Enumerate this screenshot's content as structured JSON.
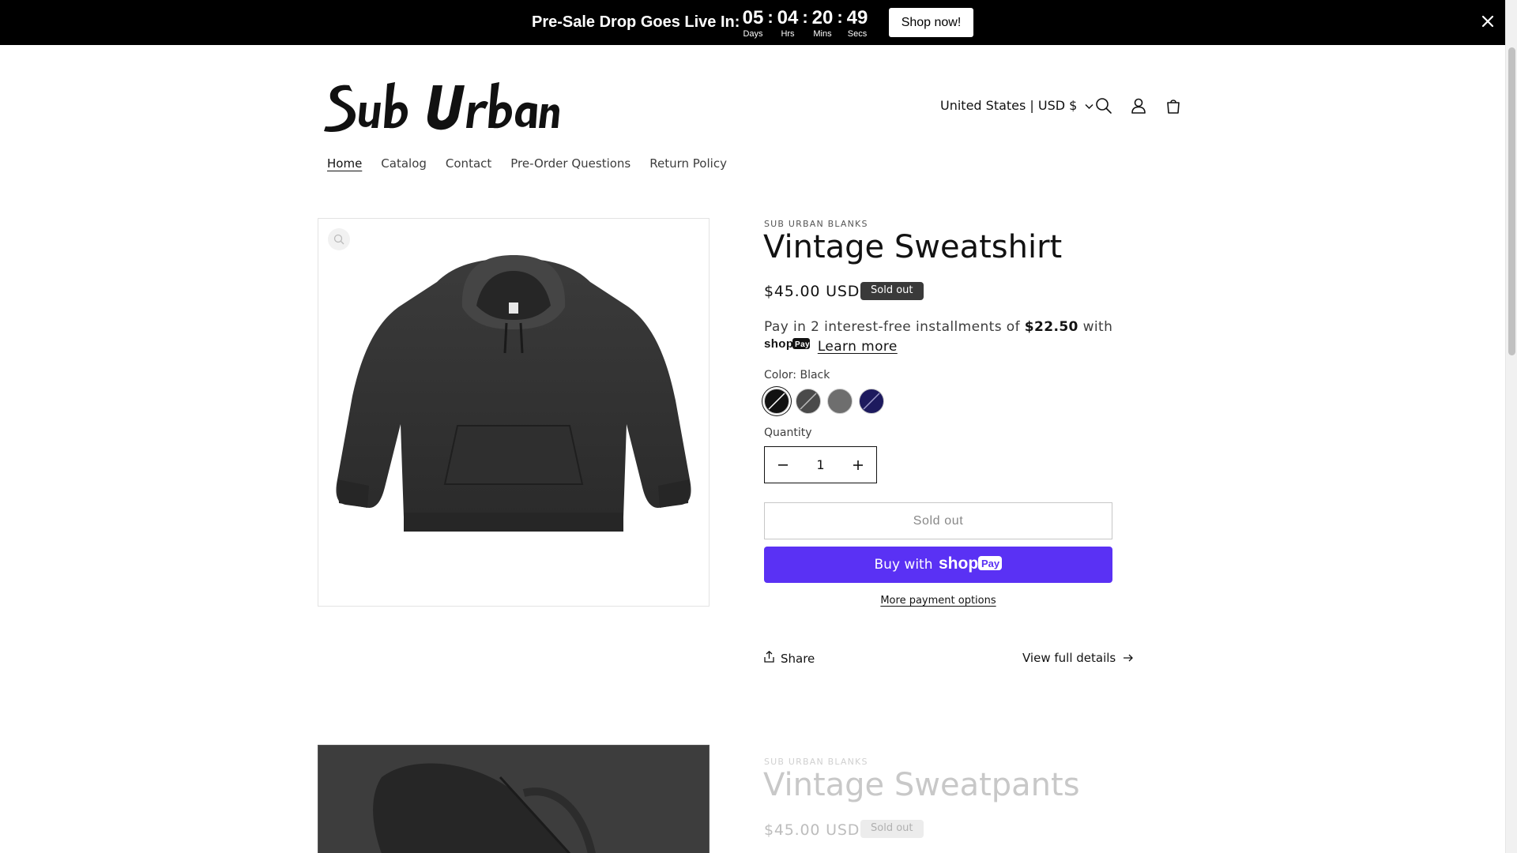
{
  "announcement": {
    "title": "Pre-Sale Drop Goes Live In:",
    "countdown": {
      "days": "05",
      "days_label": "Days",
      "hours": "04",
      "hours_label": "Hrs",
      "mins": "20",
      "mins_label": "Mins",
      "secs": "49",
      "secs_label": "Secs",
      "separator": ":"
    },
    "cta_label": "Shop now!",
    "close_icon": "close-icon"
  },
  "header": {
    "logo_text": "Sub Urban",
    "localization_label": "United States | USD $",
    "icons": [
      "search-icon",
      "account-icon",
      "cart-icon"
    ]
  },
  "nav": {
    "items": [
      {
        "label": "Home",
        "active": true
      },
      {
        "label": "Catalog"
      },
      {
        "label": "Contact"
      },
      {
        "label": "Pre-Order Questions"
      },
      {
        "label": "Return Policy"
      }
    ]
  },
  "product": {
    "vendor": "SUB URBAN BLANKS",
    "title": "Vintage Sweatshirt",
    "price": "$45.00 USD",
    "badge": "Sold out",
    "installments": {
      "prefix": "Pay in 2 interest-free installments of",
      "amount": "$22.50",
      "suffix": "with",
      "learn_more": "Learn more"
    },
    "color_label": "Color: Black",
    "swatches": [
      {
        "name": "Black",
        "color": "#121212",
        "selected": true,
        "crossed": true
      },
      {
        "name": "Charcoal",
        "color": "#4a4a4a",
        "crossed": true
      },
      {
        "name": "Grey",
        "color": "#6e6e6e",
        "crossed": false
      },
      {
        "name": "Navy",
        "color": "#1d1a5e",
        "crossed": true
      }
    ],
    "quantity_label": "Quantity",
    "quantity_value": "1",
    "sold_out_button": "Sold out",
    "buy_with_label": "Buy with",
    "more_payment": "More payment options",
    "share_label": "Share",
    "view_full_label": "View full details"
  },
  "next_product": {
    "vendor": "SUB URBAN BLANKS",
    "title": "Vintage Sweatpants",
    "price": "$45.00 USD",
    "badge": "Sold out"
  },
  "colors": {
    "shop_pay_purple": "#5a31f4",
    "announcement_bg": "#000000"
  }
}
